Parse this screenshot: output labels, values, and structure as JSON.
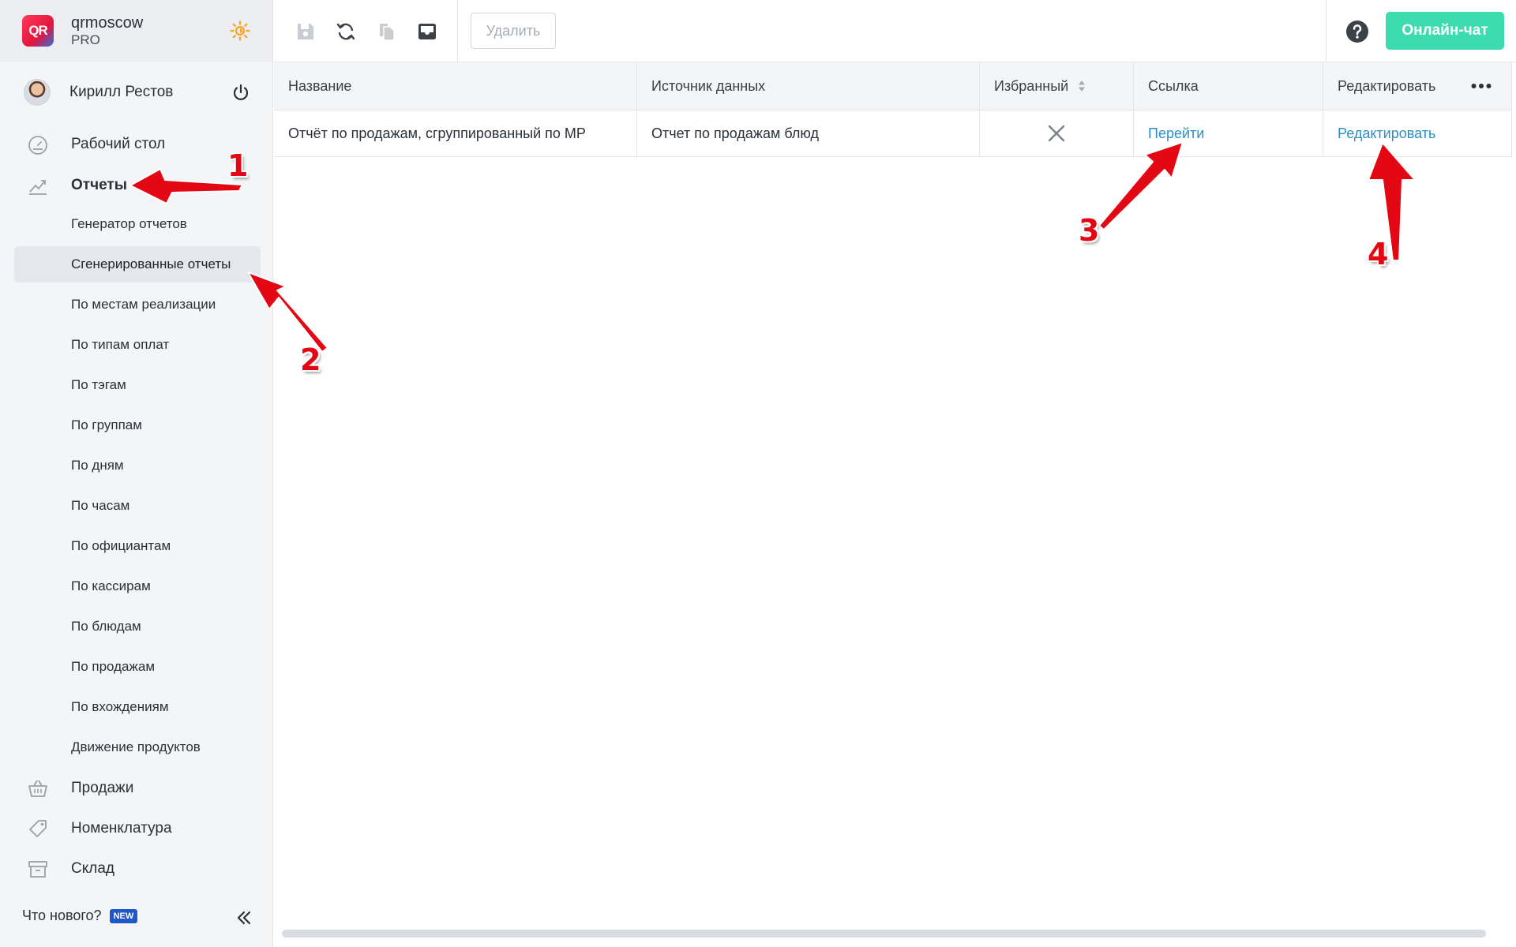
{
  "brand": {
    "name": "qrmoscow",
    "plan": "PRO",
    "logo_text": "QR"
  },
  "user": {
    "name": "Кирилл Рестов"
  },
  "nav": {
    "desktop": "Рабочий стол",
    "reports": "Отчеты",
    "sub_items": [
      "Генератор отчетов",
      "Сгенерированные отчеты",
      "По местам реализации",
      "По типам оплат",
      "По тэгам",
      "По группам",
      "По дням",
      "По часам",
      "По официантам",
      "По кассирам",
      "По блюдам",
      "По продажам",
      "По вхождениям",
      "Движение продуктов"
    ],
    "active_sub": "Сгенерированные отчеты",
    "sales": "Продажи",
    "nomenclature": "Номенклатура",
    "warehouse": "Склад"
  },
  "footer": {
    "whats_new": "Что нового?",
    "new_badge": "NEW"
  },
  "toolbar": {
    "delete_label": "Удалить",
    "chat_label": "Онлайн-чат"
  },
  "table": {
    "columns": [
      "Название",
      "Источник данных",
      "Избранный",
      "Ссылка",
      "Редактировать"
    ],
    "rows": [
      {
        "name": "Отчёт по продажам, сгруппированный по МР",
        "source": "Отчет по продажам блюд",
        "favorite": false,
        "link": "Перейти",
        "edit": "Редактировать"
      }
    ]
  },
  "annotations": {
    "n1": "1",
    "n2": "2",
    "n3": "3",
    "n4": "4"
  },
  "colors": {
    "accent": "#3ddbb0",
    "link": "#2a8fc7",
    "arrow": "#e30613",
    "badge": "#1f57c8"
  }
}
